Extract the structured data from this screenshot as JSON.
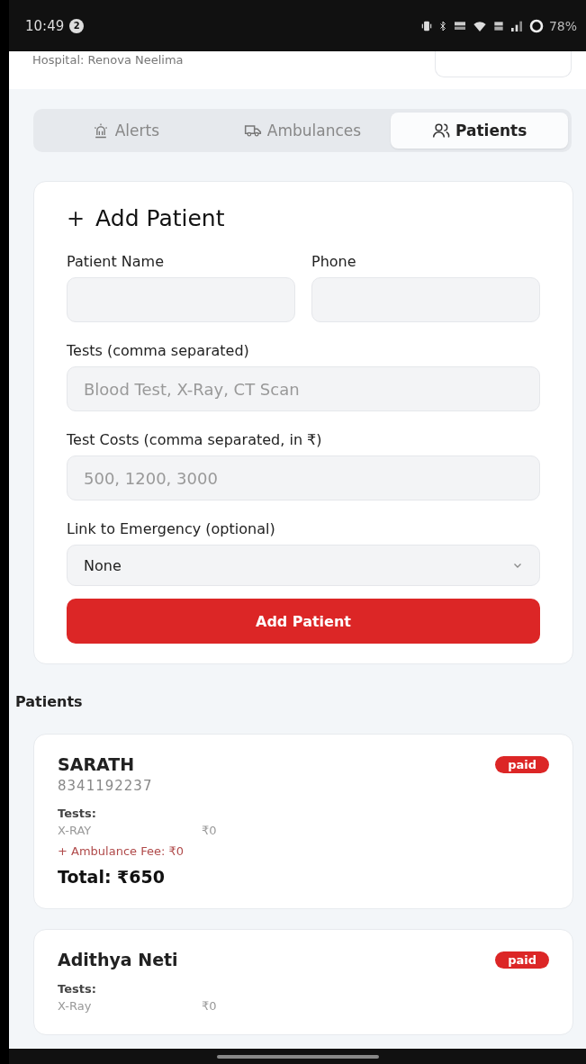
{
  "status_bar": {
    "time": "10:49",
    "notification_count": "2",
    "battery": "78%"
  },
  "header": {
    "hospital": "Hospital: Renova Neelima"
  },
  "tabs": [
    {
      "label": "Alerts",
      "selected": false
    },
    {
      "label": "Ambulances",
      "selected": false
    },
    {
      "label": "Patients",
      "selected": true
    }
  ],
  "form": {
    "title": "Add Patient",
    "title_icon": "+",
    "fields": [
      {
        "kind": "half",
        "label": "Patient Name"
      },
      {
        "kind": "half",
        "label": "Phone"
      },
      {
        "kind": "input",
        "label": "Tests (comma separated)",
        "placeholder": "Blood Test, X-Ray, CT Scan"
      },
      {
        "kind": "input",
        "label": "Test Costs (comma separated, in ₹)",
        "placeholder": "500, 1200, 3000"
      },
      {
        "kind": "select",
        "label": "Link to Emergency (optional)",
        "value": "None"
      }
    ],
    "submit": "Add Patient"
  },
  "patients_heading": "Patients",
  "patients": [
    {
      "name": "SARATH",
      "phone": "8341192237",
      "status": "paid",
      "tests_label": "Tests:",
      "tests": [
        {
          "name": "X-RAY",
          "cost": "₹0"
        }
      ],
      "ambulance_fee": "+ Ambulance Fee: ₹0",
      "total": "Total: ₹650"
    },
    {
      "name": "Adithya Neti",
      "status": "paid",
      "tests_label": "Tests:",
      "tests": [
        {
          "name": "X-Ray",
          "cost": "₹0"
        }
      ]
    }
  ]
}
